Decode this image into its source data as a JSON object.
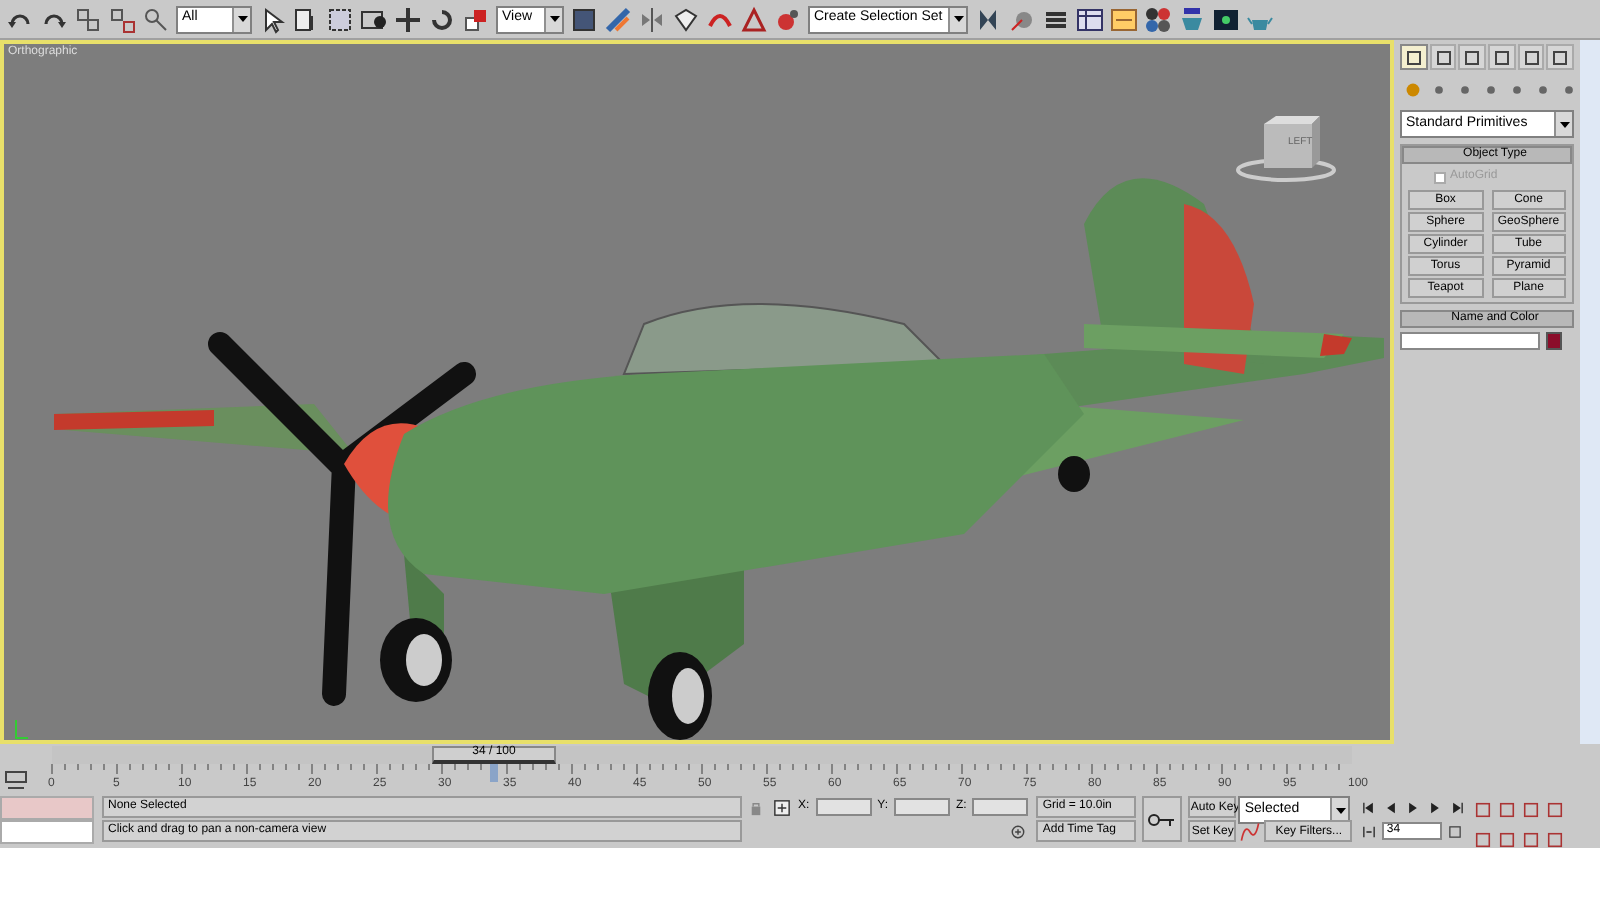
{
  "toolbar": {
    "selection_filter": "All",
    "reference_coord": "View",
    "named_selection": "Create Selection Set"
  },
  "viewport": {
    "label": "Orthographic",
    "cube_labels": [
      "LEFT"
    ]
  },
  "command_panel": {
    "tabs": [
      {
        "selected": true
      },
      {
        "selected": false
      },
      {
        "selected": false
      },
      {
        "selected": false
      },
      {
        "selected": false
      },
      {
        "selected": false
      }
    ],
    "category": "Standard Primitives",
    "object_type": {
      "title": "Object Type",
      "autogrid": {
        "label": "AutoGrid",
        "checked": false,
        "disabled": true
      },
      "buttons": [
        "Box",
        "Cone",
        "Sphere",
        "GeoSphere",
        "Cylinder",
        "Tube",
        "Torus",
        "Pyramid",
        "Teapot",
        "Plane"
      ]
    },
    "name_and_color": {
      "title": "Name and Color",
      "color": "#8b0d2a"
    }
  },
  "time_slider": {
    "frame": "34 / 100",
    "level": 0.34
  },
  "track_bar": {
    "ticks": [
      "0",
      "5",
      "10",
      "15",
      "20",
      "25",
      "30",
      "35",
      "40",
      "45",
      "50",
      "55",
      "60",
      "65",
      "70",
      "75",
      "80",
      "85",
      "90",
      "95",
      "100"
    ]
  },
  "status": {
    "selection": "None Selected",
    "prompt": "Click and drag to pan a non-camera view",
    "x_label": "X:",
    "y_label": "Y:",
    "z_label": "Z:",
    "grid": "Grid = 10.0in",
    "add_time_tag": "Add Time Tag"
  },
  "animation": {
    "auto_key": "Auto Key",
    "key_mode": "Selected",
    "set_key": "Set Key",
    "key_filters": "Key Filters...",
    "current_frame": "34"
  }
}
